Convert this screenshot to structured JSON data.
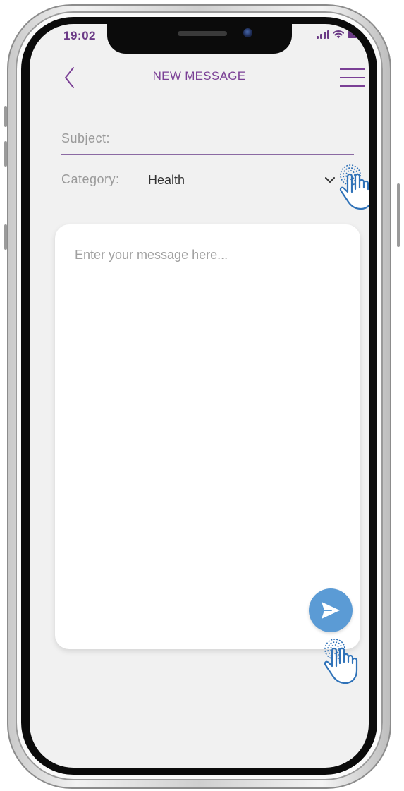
{
  "status_bar": {
    "time": "19:02"
  },
  "header": {
    "title": "NEW MESSAGE"
  },
  "form": {
    "subject_label": "Subject:",
    "category_label": "Category:",
    "category_value": "Health",
    "message_placeholder": "Enter your message here..."
  },
  "icons": {
    "back": "chevron-left-icon",
    "menu": "hamburger-menu-icon",
    "dropdown": "chevron-down-icon",
    "send": "paper-plane-icon",
    "tap_hint": "tap-hand-icon"
  },
  "colors": {
    "accent_purple": "#7a3f95",
    "send_blue": "#5b9bd5",
    "hint_blue": "#2f72b8",
    "screen_bg": "#f1f1f1"
  }
}
